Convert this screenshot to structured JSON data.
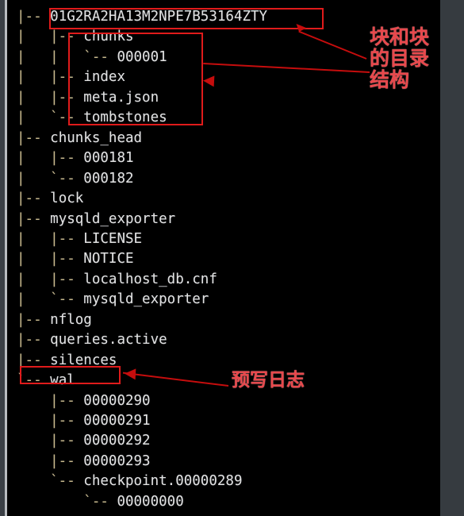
{
  "terminal": {
    "background_color": "#000000",
    "text_color": "#d6d6d6",
    "lines": [
      {
        "indent": "|-- ",
        "name": "01G2RA2HA13M2NPE7B53164ZTY"
      },
      {
        "indent": "|   |-- ",
        "name": "chunks"
      },
      {
        "indent": "|   |   `-- ",
        "name": "000001"
      },
      {
        "indent": "|   |-- ",
        "name": "index"
      },
      {
        "indent": "|   |-- ",
        "name": "meta.json"
      },
      {
        "indent": "|   `-- ",
        "name": "tombstones"
      },
      {
        "indent": "|-- ",
        "name": "chunks_head"
      },
      {
        "indent": "|   |-- ",
        "name": "000181"
      },
      {
        "indent": "|   `-- ",
        "name": "000182"
      },
      {
        "indent": "|-- ",
        "name": "lock"
      },
      {
        "indent": "|-- ",
        "name": "mysqld_exporter"
      },
      {
        "indent": "|   |-- ",
        "name": "LICENSE"
      },
      {
        "indent": "|   |-- ",
        "name": "NOTICE"
      },
      {
        "indent": "|   |-- ",
        "name": "localhost_db.cnf"
      },
      {
        "indent": "|   `-- ",
        "name": "mysqld_exporter"
      },
      {
        "indent": "|-- ",
        "name": "nflog"
      },
      {
        "indent": "|-- ",
        "name": "queries.active"
      },
      {
        "indent": "|-- ",
        "name": "silences"
      },
      {
        "indent": "`-- ",
        "name": "wal"
      },
      {
        "indent": "    |-- ",
        "name": "00000290"
      },
      {
        "indent": "    |-- ",
        "name": "00000291"
      },
      {
        "indent": "    |-- ",
        "name": "00000292"
      },
      {
        "indent": "    |-- ",
        "name": "00000293"
      },
      {
        "indent": "    `-- ",
        "name": "checkpoint.00000289"
      },
      {
        "indent": "        `-- ",
        "name": "00000000"
      }
    ]
  },
  "annotations": {
    "accent_color": "#e01b1b",
    "label_color": "#e8484c",
    "boxes": [
      {
        "id": "ulid-box",
        "target": "01G2RA2HA13M2NPE7B53164ZTY"
      },
      {
        "id": "chunks-box",
        "target": "chunks / 000001 / index / meta.json / tombstones"
      },
      {
        "id": "wal-box",
        "target": "wal"
      }
    ],
    "labels": [
      {
        "id": "block-structure-label",
        "text": "块和块\n的目录\n结构"
      },
      {
        "id": "wal-label",
        "text": "预写日志"
      }
    ]
  }
}
